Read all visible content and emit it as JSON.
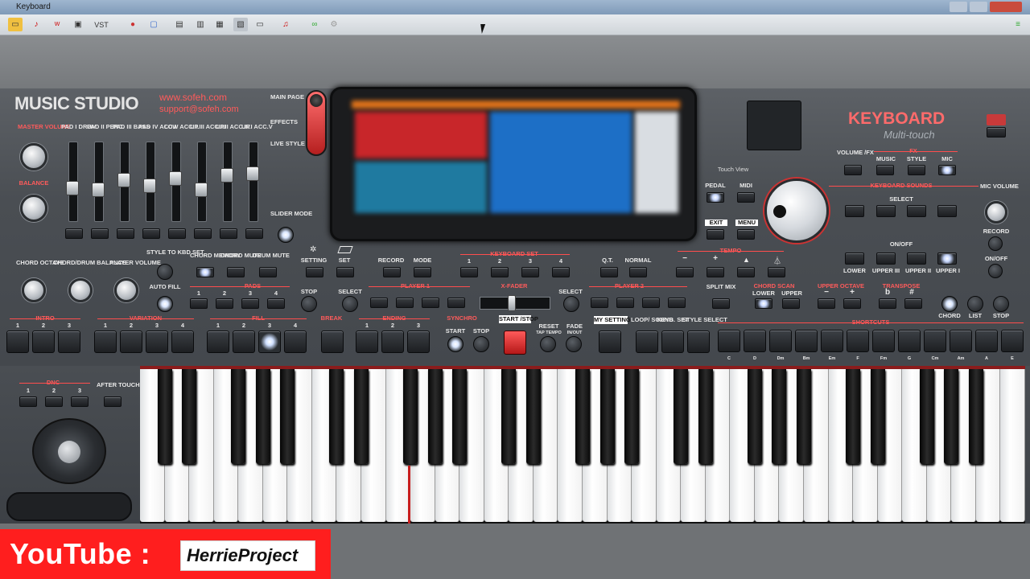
{
  "window": {
    "title": "Keyboard"
  },
  "toolbar": {
    "vst_label": "VST"
  },
  "brand": {
    "name": "MUSIC STUDIO",
    "website": "www.sofeh.com",
    "email": "support@sofeh.com",
    "product": "KEYBOARD",
    "product_sub": "Multi-touch"
  },
  "left": {
    "master_volume": "MASTER VOLUME",
    "balance": "BALANCE",
    "slider_mode": "SLIDER MODE",
    "sliders": [
      "PAD I DRUM",
      "PAD II PERC.",
      "PAD III BASS",
      "PAD IV ACC.I",
      "LOW ACC.II",
      "UP.III ACC.III",
      "UP.II ACC.IV",
      "UP.I ACC.V"
    ],
    "slider_levels": [
      0.4,
      0.38,
      0.52,
      0.44,
      0.55,
      0.38,
      0.6,
      0.62
    ]
  },
  "screen_modes": [
    "MAIN PAGE",
    "EFFECTS",
    "LIVE STYLE"
  ],
  "touch_view": "Touch View",
  "right_top": {
    "volume_fx": "VOLUME /FX",
    "fx": "FX",
    "music": "MUSIC",
    "style": "STYLE",
    "mic": "MIC",
    "pedal": "PEDAL",
    "midi": "MIDI",
    "exit": "EXIT",
    "menu": "MENU",
    "keyboard_sounds": "KEYBOARD SOUNDS",
    "select": "SELECT",
    "on_off": "ON/OFF",
    "lower": "LOWER",
    "upper3": "UPPER III",
    "upper2": "UPPER II",
    "upper1": "UPPER I",
    "mic_volume": "MIC VOLUME",
    "record": "RECORD",
    "on_off2": "ON/OFF"
  },
  "row1": {
    "chord_octave": "CHORD OCTAVE",
    "chord_drum_balance": "CHORD/DRUM BALANCE",
    "player_volume": "PLAYER VOLUME",
    "style_to_kbd": "STYLE TO KBD SET",
    "chord_memory": "CHORD MEMORY",
    "chord_mute": "CHORD MUTE",
    "drum_mute": "DRUM MUTE",
    "setting": "SETTING",
    "set": "SET",
    "record": "RECORD",
    "mode": "MODE",
    "keyboard_set": "KEYBOARD SET",
    "ks": [
      "1",
      "2",
      "3",
      "4"
    ],
    "qt": "Q.T.",
    "normal": "NORMAL",
    "tempo": "TEMPO",
    "minus": "−",
    "plus": "+"
  },
  "row2": {
    "auto_fill": "AUTO FILL",
    "pads": "PADS",
    "pad_nums": [
      "1",
      "2",
      "3",
      "4"
    ],
    "stop": "STOP",
    "select": "SELECT",
    "player1": "PLAYER 1",
    "xfader": "X-FADER",
    "select2": "SELECT",
    "player2": "PLAYER 2",
    "split_mix": "SPLIT MIX",
    "chord_scan": "CHORD SCAN",
    "lower": "LOWER",
    "upper": "UPPER",
    "upper_octave": "UPPER OCTAVE",
    "transpose": "TRANSPOSE",
    "uo_minus": "−",
    "uo_plus": "+",
    "flat": "b",
    "sharp": "#",
    "chord": "CHORD",
    "list": "LIST",
    "stop2": "STOP"
  },
  "row3": {
    "intro": "INTRO",
    "intro_nums": [
      "1",
      "2",
      "3"
    ],
    "variation": "VARIATION",
    "var_nums": [
      "1",
      "2",
      "3",
      "4"
    ],
    "fill": "FILL",
    "fill_nums": [
      "1",
      "2",
      "3",
      "4"
    ],
    "break": "BREAK",
    "ending": "ENDING",
    "end_nums": [
      "1",
      "2",
      "3"
    ],
    "synchro": "SYNCHRO",
    "start": "START",
    "stop": "STOP",
    "start_stop": "START /STOP",
    "reset": "RESET",
    "tap_tempo": "TAP TEMPO",
    "fade": "FADE",
    "in_out": "IN/OUT",
    "my_setting": "MY SETTING",
    "loop_sound": "LOOP/ SOUND",
    "keyb_set": "KEYB. SET",
    "style_select": "STYLE SELECT",
    "shortcuts": "SHORTCUTS",
    "chords": [
      "C",
      "D",
      "Dm",
      "Bm",
      "Em",
      "F",
      "Fm",
      "G",
      "Cm",
      "Am",
      "A",
      "E"
    ]
  },
  "lower": {
    "dnc": "DNC",
    "dnc_nums": [
      "1",
      "2",
      "3"
    ],
    "after_touch": "AFTER TOUCH"
  },
  "overlay": {
    "youtube": "YouTube :",
    "channel": "HerrieProject"
  }
}
